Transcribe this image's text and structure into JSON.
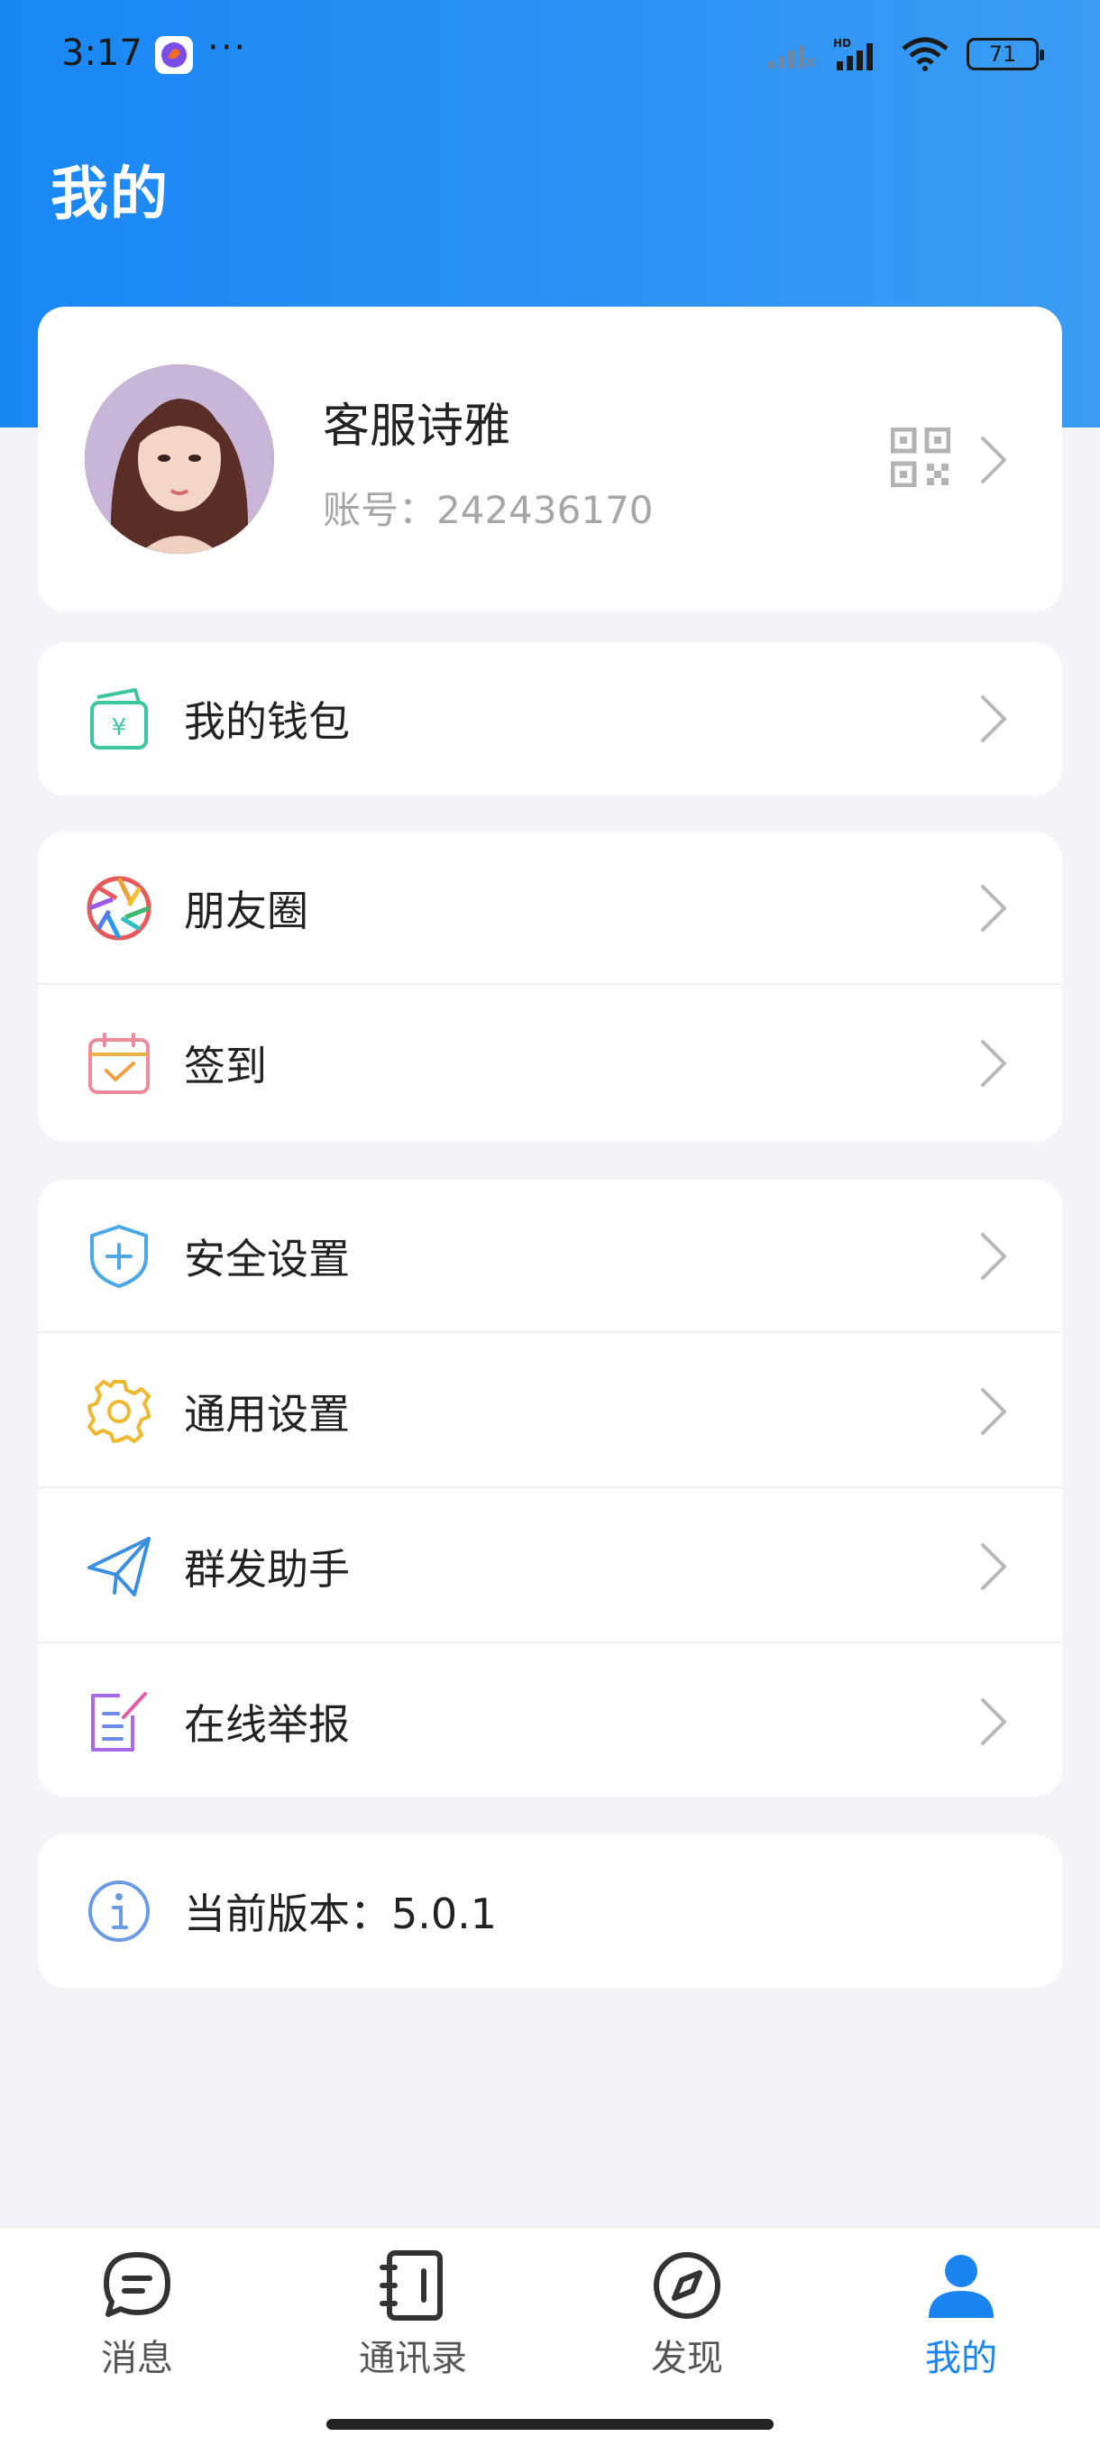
{
  "status_bar": {
    "time": "3:17",
    "dots": "···",
    "battery": "71",
    "network": "HD"
  },
  "header": {
    "title": "我的"
  },
  "profile": {
    "name": "客服诗雅",
    "account_label": "账号：",
    "account_value": "242436170",
    "avatar_icon": "avatar-photo",
    "qr_icon": "qr-code-icon"
  },
  "menu": {
    "wallet": {
      "label": "我的钱包",
      "icon": "wallet-icon"
    },
    "moments": {
      "label": "朋友圈",
      "icon": "camera-aperture-icon"
    },
    "checkin": {
      "label": "签到",
      "icon": "calendar-check-icon"
    },
    "security": {
      "label": "安全设置",
      "icon": "shield-plus-icon"
    },
    "general": {
      "label": "通用设置",
      "icon": "gear-icon"
    },
    "broadcast": {
      "label": "群发助手",
      "icon": "paper-plane-icon"
    },
    "report": {
      "label": "在线举报",
      "icon": "edit-note-icon"
    },
    "version": {
      "label": "当前版本：5.0.1",
      "icon": "info-icon"
    }
  },
  "bottom_nav": {
    "items": [
      {
        "label": "消息",
        "icon": "chat-bubble-icon",
        "active": false
      },
      {
        "label": "通讯录",
        "icon": "contacts-book-icon",
        "active": false
      },
      {
        "label": "发现",
        "icon": "compass-icon",
        "active": false
      },
      {
        "label": "我的",
        "icon": "person-icon",
        "active": true
      }
    ]
  },
  "colors": {
    "header_gradient_start": "#1a87f5",
    "header_gradient_end": "#3a9cf3",
    "accent": "#1a84f0",
    "background": "#f3f4f8"
  }
}
